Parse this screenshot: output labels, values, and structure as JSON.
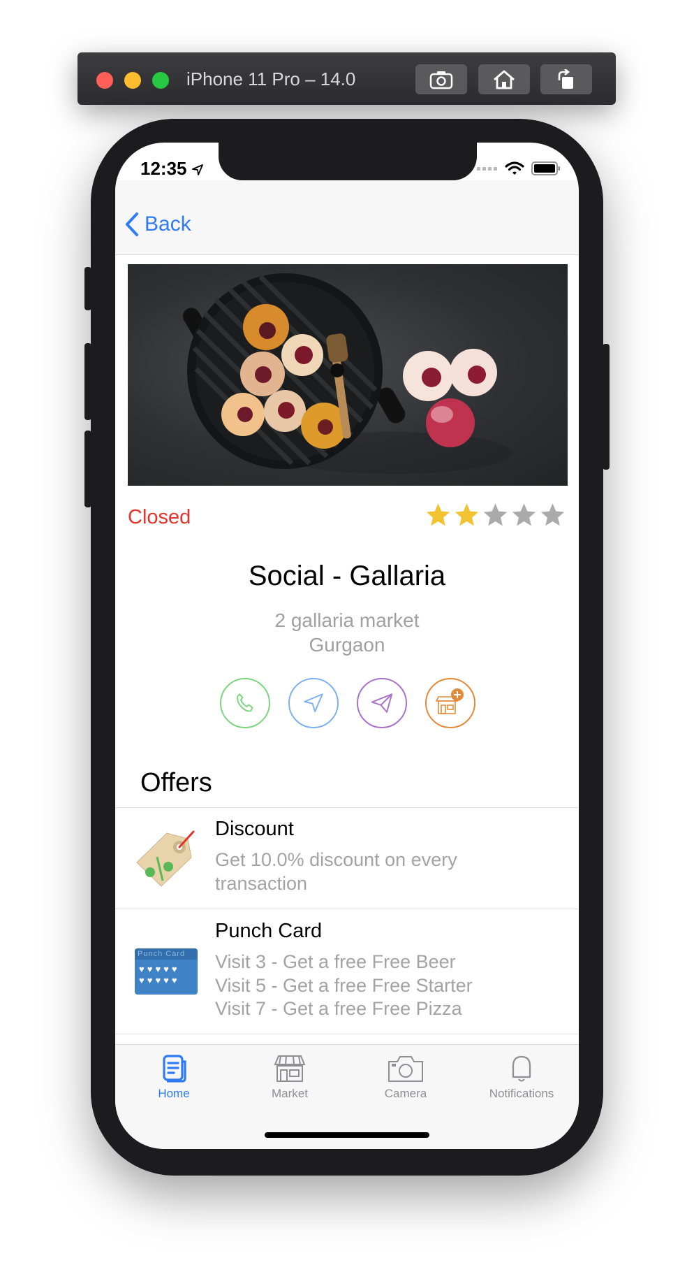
{
  "simulator": {
    "title": "iPhone 11 Pro – 14.0",
    "buttons": [
      "screenshot-icon",
      "home-icon",
      "rotate-icon"
    ]
  },
  "status_bar": {
    "time": "12:35"
  },
  "navbar": {
    "back_label": "Back"
  },
  "venue": {
    "status": "Closed",
    "rating": 2,
    "rating_max": 5,
    "name": "Social - Gallaria",
    "address_line1": "2 gallaria market",
    "address_line2": "Gurgaon",
    "actions": [
      {
        "icon": "phone-icon",
        "color": "#7ed483"
      },
      {
        "icon": "navigation-icon",
        "color": "#7fb1ee"
      },
      {
        "icon": "send-icon",
        "color": "#a873c9"
      },
      {
        "icon": "add-store-icon",
        "color": "#e38a3a"
      }
    ]
  },
  "offers": {
    "heading": "Offers",
    "items": [
      {
        "icon": "discount-tag-icon",
        "title": "Discount",
        "lines": [
          "Get 10.0% discount on every",
          "transaction"
        ]
      },
      {
        "icon": "punch-card-icon",
        "title": "Punch Card",
        "card_label": "Punch Card",
        "lines": [
          "Visit 3 - Get a free Free Beer",
          "Visit 5 - Get a free Free Starter",
          "Visit 7 - Get a free Free Pizza"
        ]
      }
    ]
  },
  "tabbar": {
    "tabs": [
      {
        "label": "Home",
        "icon": "home-feed-icon",
        "active": true
      },
      {
        "label": "Market",
        "icon": "market-icon",
        "active": false
      },
      {
        "label": "Camera",
        "icon": "camera-icon",
        "active": false
      },
      {
        "label": "Notifications",
        "icon": "bell-icon",
        "active": false
      }
    ]
  },
  "colors": {
    "accent": "#2f7bf5",
    "closed": "#e0342c",
    "star_filled": "#f1c232",
    "star_empty": "#aaaaaa"
  }
}
